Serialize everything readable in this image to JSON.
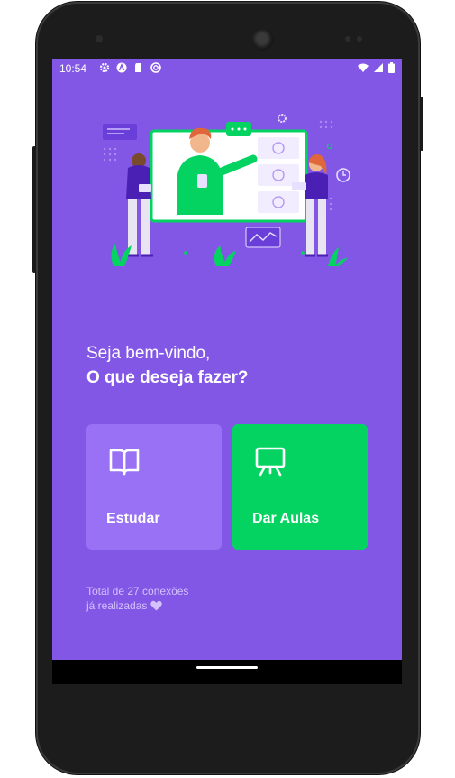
{
  "status_bar": {
    "time": "10:54",
    "left_icons": [
      "gear-icon",
      "a-logo-icon",
      "sd-card-icon",
      "sync-icon"
    ],
    "right_icons": [
      "wifi-icon",
      "signal-icon",
      "battery-icon"
    ]
  },
  "greeting": {
    "line1": "Seja bem-vindo,",
    "line2": "O que deseja fazer?"
  },
  "actions": {
    "study": {
      "label": "Estudar",
      "icon": "book-icon",
      "color": "#9871f5"
    },
    "teach": {
      "label": "Dar Aulas",
      "icon": "presentation-icon",
      "color": "#04d361"
    }
  },
  "footer": {
    "line1": "Total de 27 conexões",
    "line2": "já realizadas",
    "icon": "heart-icon"
  },
  "colors": {
    "background": "#8257e5",
    "study_button": "#9871f5",
    "teach_button": "#04d361",
    "text": "#ffffff"
  }
}
